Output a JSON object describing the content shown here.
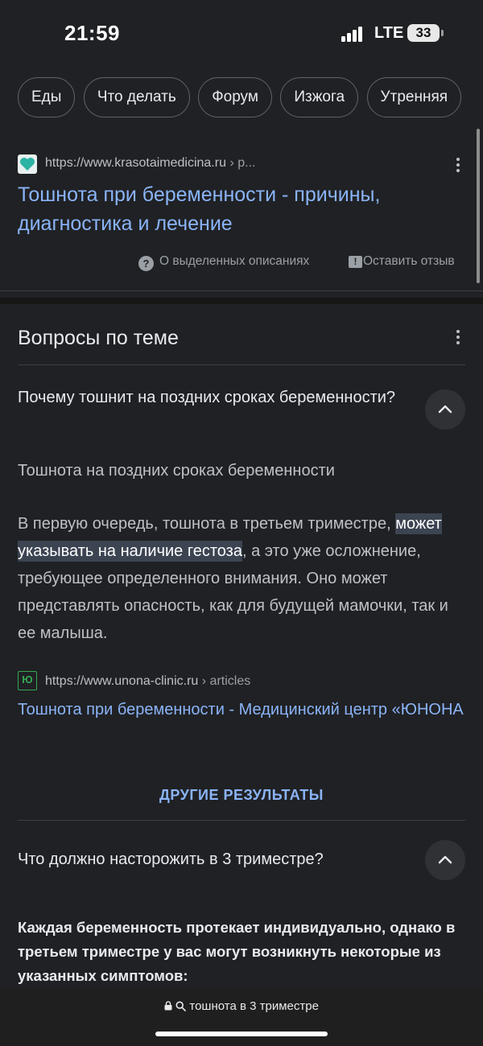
{
  "status": {
    "time": "21:59",
    "network": "LTE",
    "battery": "33"
  },
  "chips": [
    "Еды",
    "Что делать",
    "Форум",
    "Изжога",
    "Утренняя"
  ],
  "result": {
    "url": "https://www.krasotaimedicina.ru",
    "path": "› p...",
    "title": "Тошнота при беременности - причины, диагностика и лечение",
    "about": "О выделенных описаниях",
    "feedback": "Оставить отзыв"
  },
  "paa": {
    "heading": "Вопросы по теме",
    "q1": "Почему тошнит на поздних сроках беременности?",
    "a1_subtitle": "Тошнота на поздних сроках беременности",
    "a1_before": "В первую очередь, тошнота в третьем триместре, ",
    "a1_highlight": "может указывать на наличие гестоза",
    "a1_after": ", а это уже осложнение, требующее определенного внимания. Оно может представлять опасность, как для будущей мамочки, так и ее малыша.",
    "a1_source_url": "https://www.unona-clinic.ru",
    "a1_source_path": "› articles",
    "a1_source_favicon": "Ю",
    "a1_link": "Тошнота при беременности - Медицинский центр «ЮНОНА",
    "more_results": "ДРУГИЕ РЕЗУЛЬТАТЫ",
    "q2": "Что должно насторожить в 3 триместре?",
    "a2": "Каждая беременность протекает индивидуально, однако в третьем триместре у вас могут возникнуть некоторые из указанных симптомов:"
  },
  "bottom": {
    "url": "тошнота в 3 триместре"
  },
  "colors": {
    "background": "#202124",
    "link": "#8ab4f8",
    "text": "#e8eaed",
    "favicon_teal": "#2bb3a3"
  },
  "icons": [
    "signal-icon",
    "battery-icon",
    "more-vert-icon",
    "help-icon",
    "feedback-icon",
    "chevron-up-icon",
    "lock-icon",
    "search-icon"
  ]
}
